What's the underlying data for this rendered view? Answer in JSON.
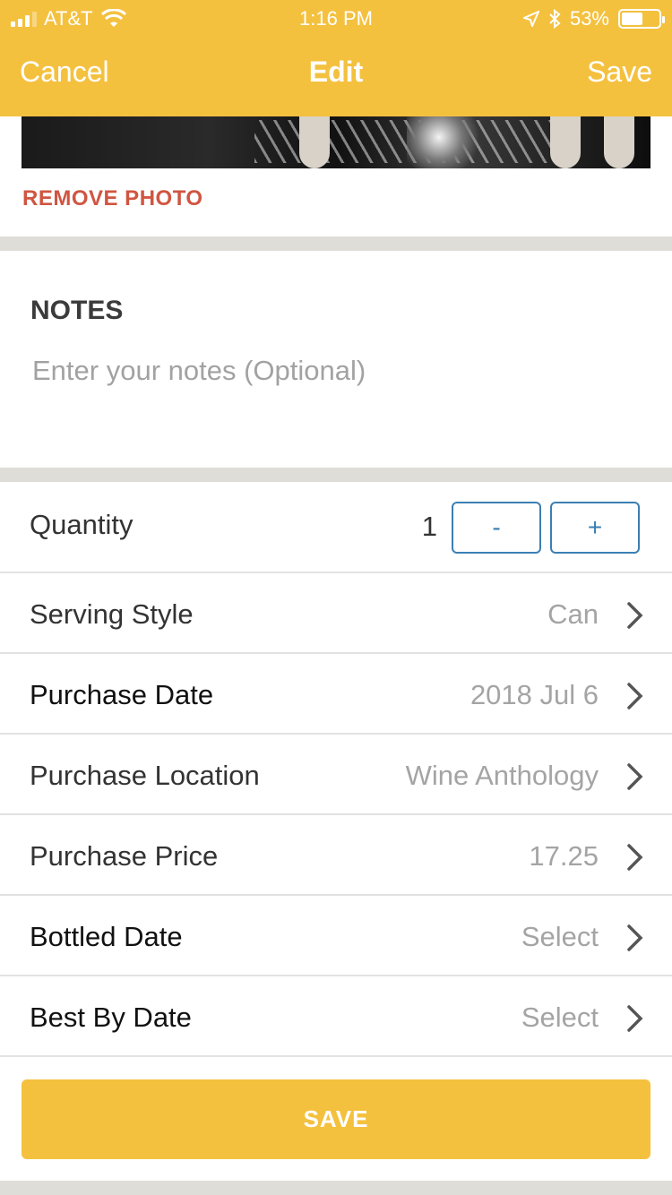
{
  "status_bar": {
    "carrier": "AT&T",
    "time": "1:16 PM",
    "battery": "53%"
  },
  "nav": {
    "cancel": "Cancel",
    "title": "Edit",
    "save": "Save"
  },
  "photo": {
    "remove_label": "REMOVE PHOTO"
  },
  "notes": {
    "title": "NOTES",
    "placeholder": "Enter your notes (Optional)"
  },
  "quantity": {
    "label": "Quantity",
    "value": "1",
    "minus": "-",
    "plus": "+"
  },
  "rows": [
    {
      "label": "Serving Style",
      "value": "Can"
    },
    {
      "label": "Purchase Date",
      "value": "2018 Jul 6"
    },
    {
      "label": "Purchase Location",
      "value": "Wine Anthology"
    },
    {
      "label": "Purchase Price",
      "value": "17.25"
    },
    {
      "label": "Bottled Date",
      "value": "Select"
    },
    {
      "label": "Best By Date",
      "value": "Select"
    }
  ],
  "footer": {
    "save_button": "SAVE"
  },
  "colors": {
    "accent": "#f4c13f",
    "danger": "#d05542",
    "stepper": "#3b7fb3"
  },
  "icons": {
    "wifi": "wifi-icon",
    "location": "location-arrow-icon",
    "bluetooth": "bluetooth-icon",
    "battery": "battery-icon",
    "chevron": "chevron-right-icon"
  }
}
